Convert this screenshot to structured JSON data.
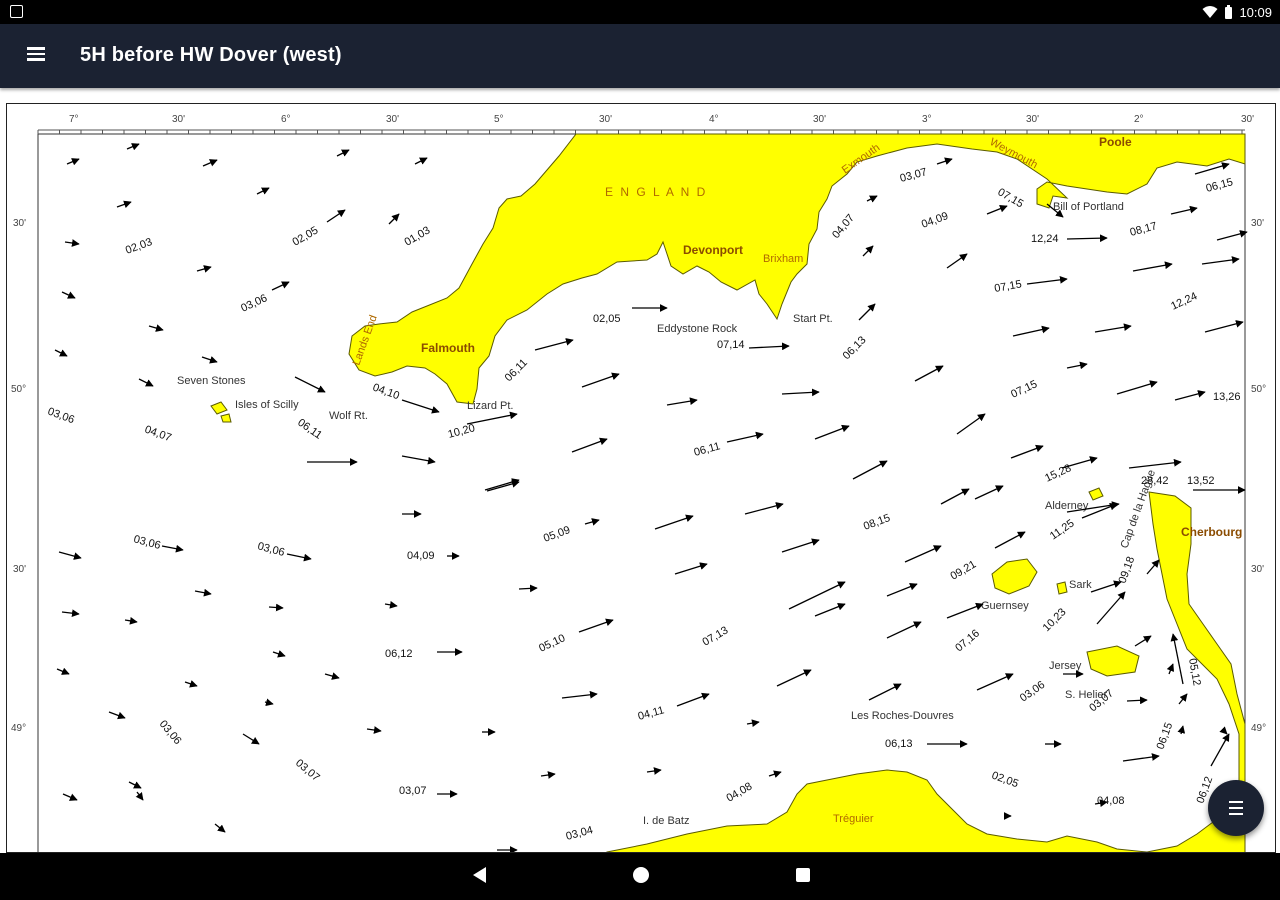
{
  "status": {
    "time": "10:09"
  },
  "app": {
    "title": "5H before HW Dover (west)"
  },
  "chart": {
    "colors": {
      "land": "#ffff00",
      "coast": "#5b5b00",
      "text": "#111111",
      "orange": "#b06a00"
    },
    "top_ticks": [
      "7°",
      "30'",
      "6°",
      "30'",
      "5°",
      "30'",
      "4°",
      "30'",
      "3°",
      "30'",
      "2°",
      "30'"
    ],
    "left_ticks": [
      "30'",
      "50°",
      "30'",
      "49°"
    ],
    "right_ticks": [
      "30'",
      "50°",
      "30'",
      "49°"
    ],
    "land_labels": {
      "england": "E N G L A N D"
    },
    "places": {
      "poole": "Poole",
      "exmouth": "Exmouth",
      "weymouth": "Weymouth",
      "bill": "Bill of Portland",
      "devonport": "Devonport",
      "brixham": "Brixham",
      "start": "Start Pt.",
      "eddystone": "Eddystone Rock",
      "falmouth": "Falmouth",
      "lands_end": "Lands End",
      "lizard": "Lizard Pt.",
      "seven_stones": "Seven Stones",
      "scilly": "Isles of Scilly",
      "wolf": "Wolf Rt.",
      "alderney": "Alderney",
      "cherbourg": "Cherbourg",
      "cap": "Cap de la Hague",
      "guernsey": "Guernsey",
      "sark": "Sark",
      "jersey": "Jersey",
      "helier": "S. Helier",
      "roches": "Les Roches-Douvres",
      "treguier": "Tréguier",
      "batz": "I. de Batz"
    },
    "rates": {
      "r01": "02,03",
      "r02": "02,05",
      "r03": "01,03",
      "r04": "03,06",
      "r05": "03,07",
      "r06": "04,07",
      "r07": "04,09",
      "r08": "07,15",
      "r09": "12,24",
      "r10": "08,17",
      "r11": "06,15",
      "r12": "02,05",
      "r13": "07,14",
      "r14": "06,13",
      "r15": "07,15",
      "r16": "12,24",
      "r17": "06,11",
      "r18": "04,10",
      "r19": "10,20",
      "r20": "03,06",
      "r21": "04,07",
      "r22": "06,11",
      "r23": "07,15",
      "r24": "13,26",
      "r25": "06,11",
      "r26": "15,28",
      "r27": "28,42",
      "r28": "13,52",
      "r29": "03,06",
      "r30": "03,06",
      "r31": "04,09",
      "r32": "05,09",
      "r33": "08,15",
      "r34": "11,25",
      "r35": "09,21",
      "r36": "09,18",
      "r37": "06,12",
      "r38": "05,10",
      "r39": "07,13",
      "r40": "07,16",
      "r41": "10,23",
      "r42": "03,06",
      "r43": "04,11",
      "r44": "03,06",
      "r45": "03,07",
      "r46": "06,13",
      "r47": "05,12",
      "r48": "06,15",
      "r49": "03,07",
      "r50": "03,07",
      "r51": "02,05",
      "r52": "04,08",
      "r53": "04,08",
      "r54": "03,04",
      "r55": "06,12"
    }
  }
}
